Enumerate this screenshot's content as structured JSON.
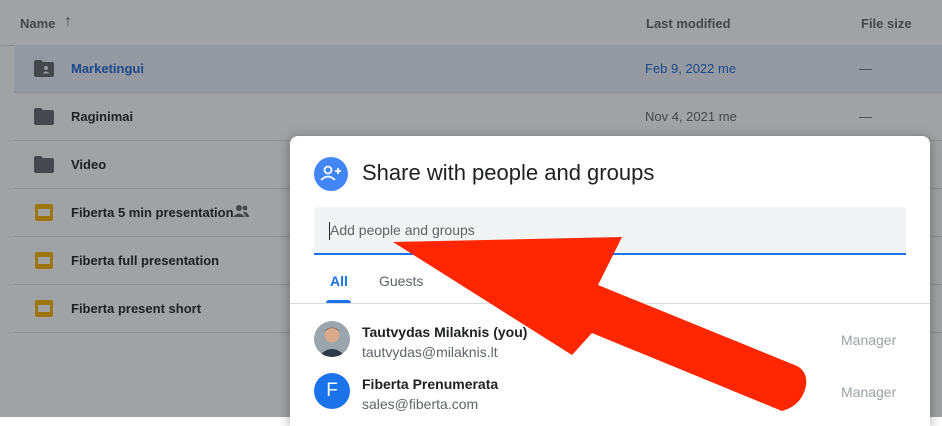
{
  "file_list": {
    "columns": {
      "name": "Name",
      "last_modified": "Last modified",
      "file_size": "File size"
    },
    "rows": [
      {
        "name": "Marketingui",
        "modified": "Feb 9, 2022",
        "owner": "me",
        "size": "—",
        "type": "shared-folder",
        "selected": true
      },
      {
        "name": "Raginimai",
        "modified": "Nov 4, 2021",
        "owner": "me",
        "size": "—",
        "type": "folder"
      },
      {
        "name": "Video",
        "modified": "",
        "owner": "",
        "size": "",
        "type": "folder"
      },
      {
        "name": "Fiberta 5 min presentation",
        "modified": "",
        "owner": "",
        "size": "",
        "type": "slides",
        "shared": true
      },
      {
        "name": "Fiberta full presentation",
        "modified": "",
        "owner": "",
        "size": "",
        "type": "slides"
      },
      {
        "name": "Fiberta present short",
        "modified": "",
        "owner": "",
        "size": "",
        "type": "slides"
      }
    ]
  },
  "share_dialog": {
    "title": "Share with people and groups",
    "input_placeholder": "Add people and groups",
    "tabs": [
      "All",
      "Guests"
    ],
    "people": [
      {
        "name": "Tautvydas Milaknis (you)",
        "email": "tautvydas@milaknis.lt",
        "role": "Manager",
        "avatar": "photo"
      },
      {
        "name": "Fiberta Prenumerata",
        "email": "sales@fiberta.com",
        "role": "Manager",
        "avatar_letter": "F"
      }
    ]
  },
  "colors": {
    "accent": "#1a73e8",
    "annotation_arrow": "#ff2600",
    "folder": "#5f6368",
    "slides": "#f4b400"
  },
  "icons": [
    "sort-arrow-up-icon",
    "shared-folder-icon",
    "folder-icon",
    "slides-icon",
    "shared-people-icon",
    "add-person-icon"
  ]
}
